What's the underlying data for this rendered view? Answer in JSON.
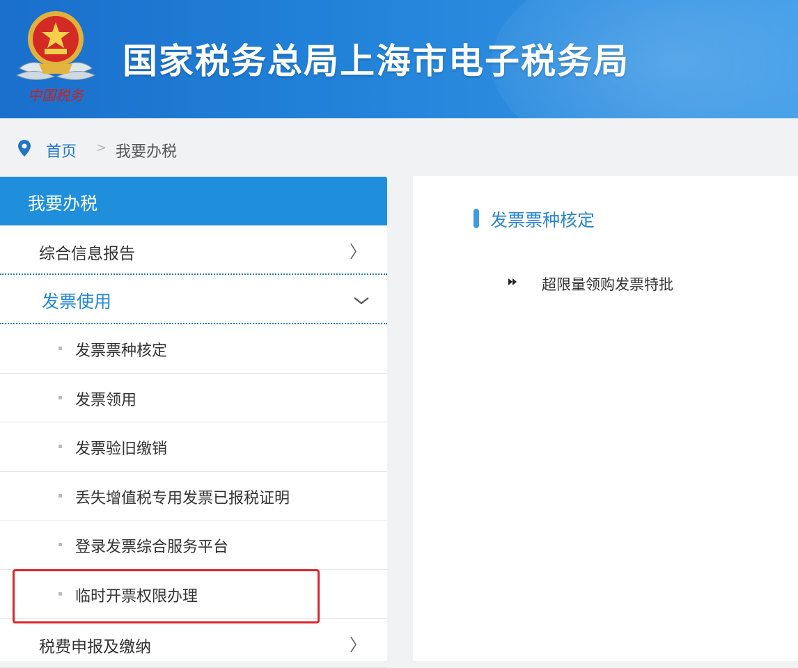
{
  "header": {
    "title": "国家税务总局上海市电子税务局",
    "emblem_icon": "tax-emblem-icon",
    "emblem_caption": "中国税务",
    "colors": {
      "gradient_start": "#1a6fcc",
      "gradient_end": "#3a9ae8"
    }
  },
  "breadcrumb": {
    "icon": "location-pin-icon",
    "home": "首页",
    "separator": ">",
    "current": "我要办税"
  },
  "sidebar": {
    "heading": "我要办税",
    "items": [
      {
        "label": "综合信息报告",
        "icon": "chevron-right-icon",
        "arrow": "〉"
      },
      {
        "label": "发票使用",
        "icon": "chevron-down-icon",
        "active": true
      }
    ],
    "sub_items": [
      {
        "label": "发票票种核定"
      },
      {
        "label": "发票领用"
      },
      {
        "label": "发票验旧缴销"
      },
      {
        "label": "丢失增值税专用发票已报税证明"
      },
      {
        "label": "登录发票综合服务平台"
      },
      {
        "label": "临时开票权限办理",
        "highlighted": true
      }
    ],
    "footer_item": {
      "label": "税费申报及缴纳",
      "icon": "chevron-right-icon",
      "arrow": "〉"
    }
  },
  "content": {
    "section_title": "发票票种核定",
    "links": [
      {
        "label": "超限量领购发票特批",
        "icon": "double-arrow-icon"
      }
    ]
  },
  "colors": {
    "accent": "#1f8fdb",
    "link_blue": "#2176c7",
    "highlight_red": "#d9262c"
  }
}
